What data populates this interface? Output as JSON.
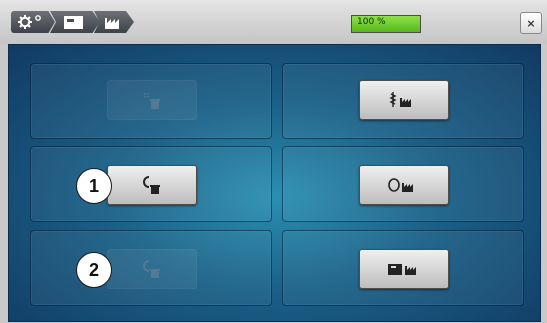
{
  "topbar": {
    "breadcrumbs": [
      {
        "icon": "gear-icon"
      },
      {
        "icon": "embroidery-module-icon"
      },
      {
        "icon": "factory-icon"
      }
    ],
    "progress": {
      "value": 1.0,
      "label": "100 %"
    },
    "close_label": "×"
  },
  "grid": {
    "left": [
      {
        "button_icon": "thread-cut-bobbin-icon",
        "enabled": false,
        "callout": ""
      },
      {
        "button_icon": "thread-spool-bobbin-icon",
        "enabled": true,
        "callout": "1"
      },
      {
        "button_icon": "thread-loop-bobbin-icon",
        "enabled": false,
        "callout": "2"
      }
    ],
    "right": [
      {
        "button_icon": "thread-stitch-factory-icon",
        "enabled": true
      },
      {
        "button_icon": "thread-circle-factory-icon",
        "enabled": true
      },
      {
        "button_icon": "embroidery-module-factory-icon",
        "enabled": true
      }
    ]
  },
  "colors": {
    "panel": "#1a5f86",
    "progress_fill": "#6ccc2a"
  }
}
